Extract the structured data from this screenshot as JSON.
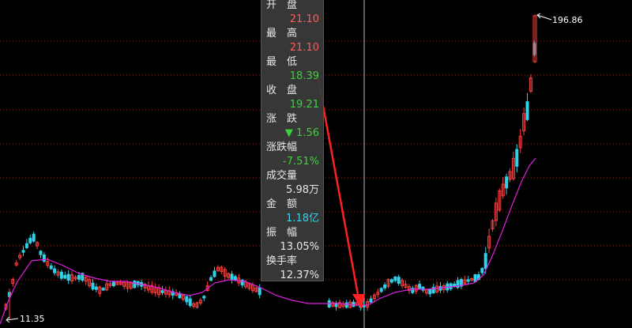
{
  "chart_data": {
    "type": "candlestick",
    "high_label": "196.86",
    "low_label": "11.35",
    "colors": {
      "up": "#ff3c3c",
      "down": "#2fd2e8",
      "ma": "#e020e0",
      "grid": "#8a2020",
      "crosshair": "#bbbbbb",
      "arrow": "#ff2020"
    }
  },
  "info_panel": {
    "rows": [
      {
        "label": "开　盘",
        "value": "21.10",
        "color": "red"
      },
      {
        "label": "最　高",
        "value": "21.10",
        "color": "red"
      },
      {
        "label": "最　低",
        "value": "18.39",
        "color": "green"
      },
      {
        "label": "收　盘",
        "value": "19.21",
        "color": "green"
      },
      {
        "label": "涨　跌",
        "value": "▼ 1.56",
        "color": "green"
      },
      {
        "label": "涨跌幅",
        "value": "-7.51%",
        "color": "green"
      },
      {
        "label": "成交量",
        "value": "5.98万",
        "color": "white"
      },
      {
        "label": "金　额",
        "value": "1.18亿",
        "color": "cyan"
      },
      {
        "label": "振　幅",
        "value": "13.05%",
        "color": "white"
      },
      {
        "label": "换手率",
        "value": "12.37%",
        "color": "white"
      }
    ]
  }
}
